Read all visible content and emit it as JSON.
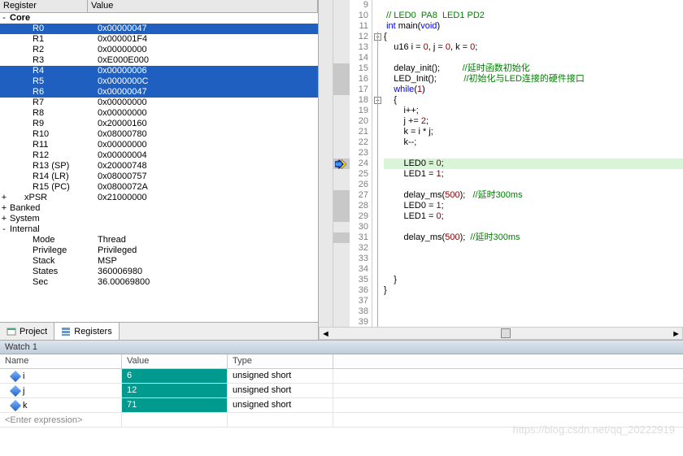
{
  "headers": {
    "register": "Register",
    "value": "Value"
  },
  "registers": [
    {
      "exp": "-",
      "ind": 0,
      "name": "Core",
      "val": "",
      "bold": true,
      "sel": false
    },
    {
      "exp": "",
      "ind": 1,
      "name": "R0",
      "val": "0x00000047",
      "sel": true
    },
    {
      "exp": "",
      "ind": 1,
      "name": "R1",
      "val": "0x000001F4",
      "sel": false
    },
    {
      "exp": "",
      "ind": 1,
      "name": "R2",
      "val": "0x00000000",
      "sel": false
    },
    {
      "exp": "",
      "ind": 1,
      "name": "R3",
      "val": "0xE000E000",
      "sel": false
    },
    {
      "exp": "",
      "ind": 1,
      "name": "R4",
      "val": "0x00000006",
      "sel": true
    },
    {
      "exp": "",
      "ind": 1,
      "name": "R5",
      "val": "0x0000000C",
      "sel": true
    },
    {
      "exp": "",
      "ind": 1,
      "name": "R6",
      "val": "0x00000047",
      "sel": true
    },
    {
      "exp": "",
      "ind": 1,
      "name": "R7",
      "val": "0x00000000",
      "sel": false
    },
    {
      "exp": "",
      "ind": 1,
      "name": "R8",
      "val": "0x00000000",
      "sel": false
    },
    {
      "exp": "",
      "ind": 1,
      "name": "R9",
      "val": "0x20000160",
      "sel": false
    },
    {
      "exp": "",
      "ind": 1,
      "name": "R10",
      "val": "0x08000780",
      "sel": false
    },
    {
      "exp": "",
      "ind": 1,
      "name": "R11",
      "val": "0x00000000",
      "sel": false
    },
    {
      "exp": "",
      "ind": 1,
      "name": "R12",
      "val": "0x00000004",
      "sel": false
    },
    {
      "exp": "",
      "ind": 1,
      "name": "R13 (SP)",
      "val": "0x20000748",
      "sel": false
    },
    {
      "exp": "",
      "ind": 1,
      "name": "R14 (LR)",
      "val": "0x08000757",
      "sel": false
    },
    {
      "exp": "",
      "ind": 1,
      "name": "R15 (PC)",
      "val": "0x0800072A",
      "sel": false
    },
    {
      "exp": "+",
      "ind": 1,
      "name": "xPSR",
      "val": "0x21000000",
      "sel": false
    },
    {
      "exp": "+",
      "ind": 0,
      "name": "Banked",
      "val": "",
      "sel": false
    },
    {
      "exp": "+",
      "ind": 0,
      "name": "System",
      "val": "",
      "sel": false
    },
    {
      "exp": "-",
      "ind": 0,
      "name": "Internal",
      "val": "",
      "sel": false
    },
    {
      "exp": "",
      "ind": 1,
      "name": "Mode",
      "val": "Thread",
      "sel": false
    },
    {
      "exp": "",
      "ind": 1,
      "name": "Privilege",
      "val": "Privileged",
      "sel": false
    },
    {
      "exp": "",
      "ind": 1,
      "name": "Stack",
      "val": "MSP",
      "sel": false
    },
    {
      "exp": "",
      "ind": 1,
      "name": "States",
      "val": "360006980",
      "sel": false
    },
    {
      "exp": "",
      "ind": 1,
      "name": "Sec",
      "val": "36.00069800",
      "sel": false
    }
  ],
  "tabs": {
    "project": "Project",
    "registers": "Registers"
  },
  "code": {
    "start": 9,
    "current_line": 24,
    "grey_lines": [
      15,
      16,
      17,
      24,
      27,
      28,
      29,
      31
    ],
    "lines": [
      {
        "n": 9,
        "t": ""
      },
      {
        "n": 10,
        "t": " // LED0  PA8  LED1 PD2",
        "cls": "cm"
      },
      {
        "n": 11,
        "html": " <span class='kw'>int</span> main(<span class='kw'>void</span>)"
      },
      {
        "n": 12,
        "t": "{"
      },
      {
        "n": 13,
        "html": "    u16 i = <span class='nm'>0</span>, j = <span class='nm'>0</span>, k = <span class='nm'>0</span>;"
      },
      {
        "n": 14,
        "t": ""
      },
      {
        "n": 15,
        "html": "    delay_init();         <span class='cm'>//延时函数初始化</span>"
      },
      {
        "n": 16,
        "html": "    LED_Init();           <span class='cm'>//初始化与LED连接的硬件接口</span>"
      },
      {
        "n": 17,
        "html": "    <span class='kw'>while</span>(<span class='nm'>1</span>)"
      },
      {
        "n": 18,
        "t": "    {"
      },
      {
        "n": 19,
        "t": "        i++;"
      },
      {
        "n": 20,
        "html": "        j += <span class='nm'>2</span>;"
      },
      {
        "n": 21,
        "t": "        k = i * j;"
      },
      {
        "n": 22,
        "t": "        k--;"
      },
      {
        "n": 23,
        "t": ""
      },
      {
        "n": 24,
        "html": "        LED0 = <span class='nm'>0</span>;",
        "hl": true
      },
      {
        "n": 25,
        "html": "        LED1 = <span class='nm'>1</span>;"
      },
      {
        "n": 26,
        "t": ""
      },
      {
        "n": 27,
        "html": "        delay_ms(<span class='nm'>500</span>);   <span class='cm'>//延时300ms</span>"
      },
      {
        "n": 28,
        "html": "        LED0 = <span class='nm'>1</span>;"
      },
      {
        "n": 29,
        "html": "        LED1 = <span class='nm'>0</span>;"
      },
      {
        "n": 30,
        "t": ""
      },
      {
        "n": 31,
        "html": "        delay_ms(<span class='nm'>500</span>);  <span class='cm'>//延时300ms</span>"
      },
      {
        "n": 32,
        "t": ""
      },
      {
        "n": 33,
        "t": ""
      },
      {
        "n": 34,
        "t": ""
      },
      {
        "n": 35,
        "t": "    }"
      },
      {
        "n": 36,
        "t": "}"
      },
      {
        "n": 37,
        "t": ""
      },
      {
        "n": 38,
        "t": ""
      },
      {
        "n": 39,
        "t": ""
      }
    ]
  },
  "watch": {
    "title": "Watch 1",
    "cols": {
      "name": "Name",
      "value": "Value",
      "type": "Type"
    },
    "rows": [
      {
        "name": "i",
        "val": "6",
        "type": "unsigned short",
        "hl": true
      },
      {
        "name": "j",
        "val": "12",
        "type": "unsigned short",
        "hl": true
      },
      {
        "name": "k",
        "val": "71",
        "type": "unsigned short",
        "hl": true
      }
    ],
    "enter": "<Enter expression>"
  },
  "watermark": "https://blog.csdn.net/qq_20222919"
}
